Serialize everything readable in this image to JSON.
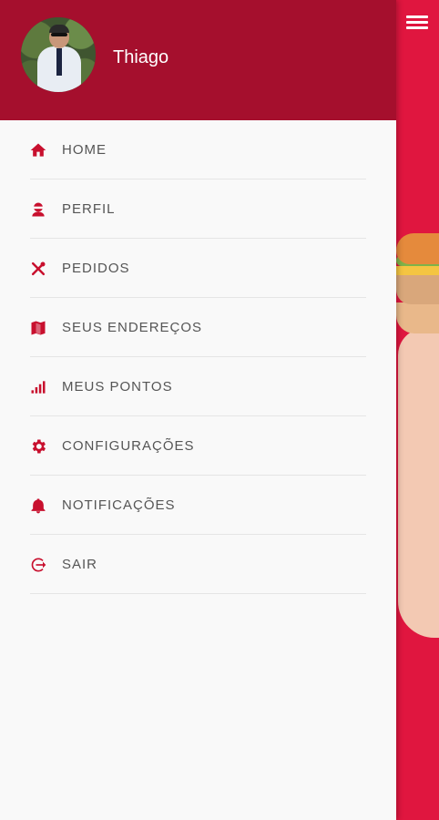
{
  "colors": {
    "primary": "#e0163f",
    "header": "#a50f2d",
    "icon": "#c8102e",
    "text": "#555555",
    "drawer_bg": "#f9f9f9"
  },
  "header": {
    "user_name": "Thiago",
    "avatar_icon": "user-avatar"
  },
  "topbar": {
    "menu_icon": "hamburger-icon"
  },
  "menu": {
    "items": [
      {
        "label": "HOME",
        "icon": "home-icon"
      },
      {
        "label": "PERFIL",
        "icon": "user-icon"
      },
      {
        "label": "PEDIDOS",
        "icon": "utensils-icon"
      },
      {
        "label": "SEUS ENDEREÇOS",
        "icon": "map-icon"
      },
      {
        "label": "MEUS PONTOS",
        "icon": "signal-icon"
      },
      {
        "label": "CONFIGURAÇÕES",
        "icon": "gear-icon"
      },
      {
        "label": "NOTIFICAÇÕES",
        "icon": "bell-icon"
      },
      {
        "label": "SAIR",
        "icon": "logout-icon"
      }
    ]
  }
}
